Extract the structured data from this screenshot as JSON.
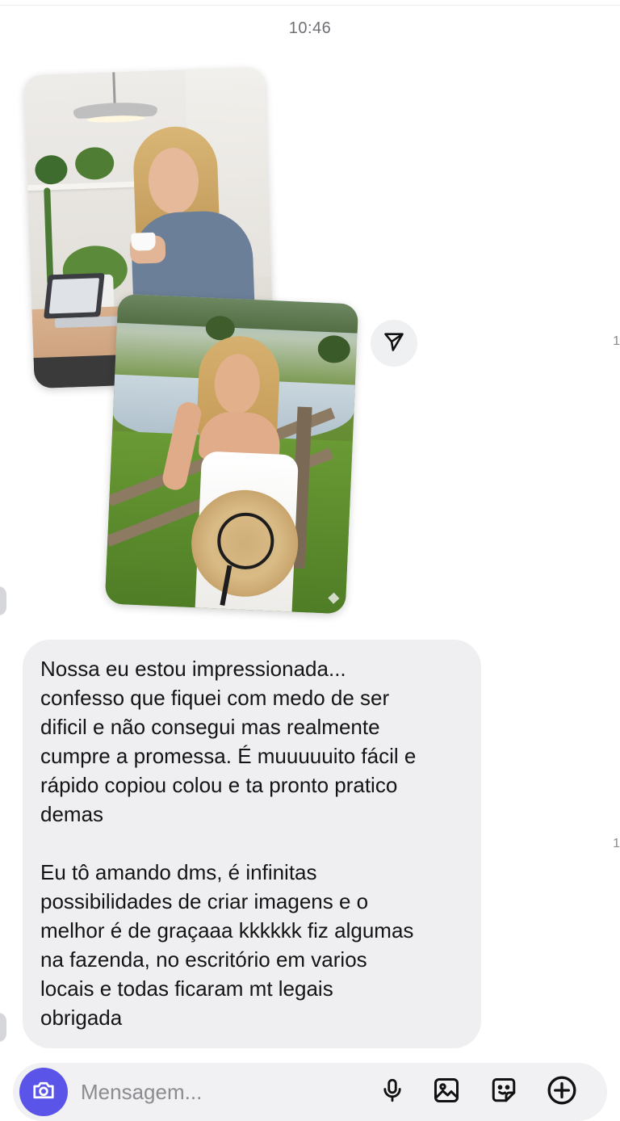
{
  "header": {
    "timestamp": "10:46"
  },
  "edge": {
    "read_count_1": "1",
    "read_count_2": "1"
  },
  "photos": [
    {
      "name": "office-photo",
      "icon": "photo"
    },
    {
      "name": "farm-photo",
      "icon": "photo"
    }
  ],
  "share": {
    "icon": "paper-plane-icon"
  },
  "message": {
    "paragraph_1": "Nossa eu estou impressionada...\nconfesso que fiquei com medo de ser\ndificil e não consegui mas realmente\ncumpre a promessa. É muuuuuito fácil e\nrápido copiou colou e ta pronto pratico\ndemas",
    "paragraph_2": "Eu tô amando dms, é infinitas\npossibilidades de criar imagens e o\nmelhor é de graçaaa kkkkkk fiz algumas\nna fazenda, no escritório em varios\nlocais e todas ficaram mt legais\nobrigada"
  },
  "composer": {
    "placeholder": "Mensagem...",
    "camera_icon": "camera-icon",
    "mic_icon": "microphone-icon",
    "gallery_icon": "image-icon",
    "sticker_icon": "sticker-icon",
    "plus_icon": "plus-circle-icon"
  },
  "colors": {
    "accent": "#5b54e8",
    "bubble": "#efeff2",
    "background": "#ffffff"
  }
}
